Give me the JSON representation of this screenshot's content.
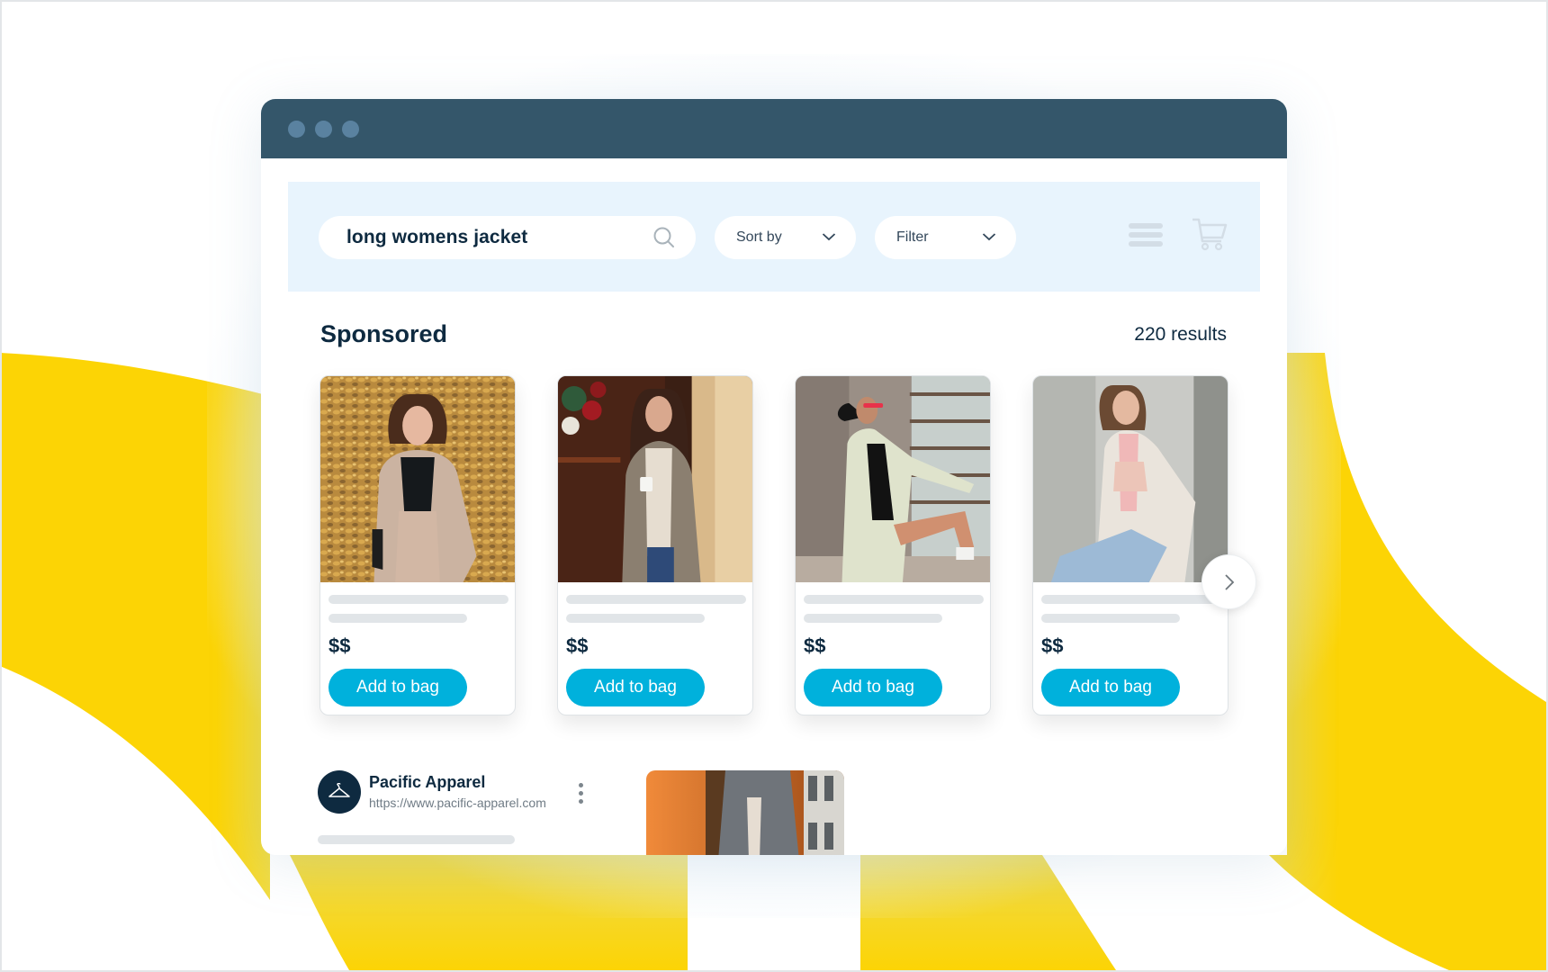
{
  "colors": {
    "brand_yellow": "#fcd405",
    "titlebar": "#34566a",
    "titlebar_dots": "#5a82a0",
    "toolbar_bg": "#e8f4fd",
    "accent_button": "#00b1dc",
    "text_primary": "#0e2a40"
  },
  "browser": {
    "window_controls": [
      "dot",
      "dot",
      "dot"
    ]
  },
  "toolbar": {
    "search": {
      "value": "long womens jacket",
      "icon": "search-icon"
    },
    "sort": {
      "label": "Sort by",
      "icon": "chevron-down-icon"
    },
    "filter": {
      "label": "Filter",
      "icon": "chevron-down-icon"
    },
    "menu_icon": "hamburger-menu-icon",
    "cart_icon": "shopping-cart-icon"
  },
  "section": {
    "title": "Sponsored",
    "results_count": "220 results"
  },
  "products": [
    {
      "image": "woman in beige blazer, autumn leaves",
      "price": "$$",
      "button_label": "Add to bag"
    },
    {
      "image": "woman in plaid coat holding mug",
      "price": "$$",
      "button_label": "Add to bag"
    },
    {
      "image": "woman in pale green shirt jacket on stairs",
      "price": "$$",
      "button_label": "Add to bag"
    },
    {
      "image": "woman in cream cardigan with pink bag",
      "price": "$$",
      "button_label": "Add to bag"
    }
  ],
  "carousel": {
    "next_icon": "chevron-right-icon"
  },
  "advertiser": {
    "name": "Pacific Apparel",
    "url": "https://www.pacific-apparel.com",
    "logo_icon": "hanger-icon",
    "more_icon": "kebab-menu-icon",
    "ad_image": "woman in grey blazer against orange wall"
  }
}
